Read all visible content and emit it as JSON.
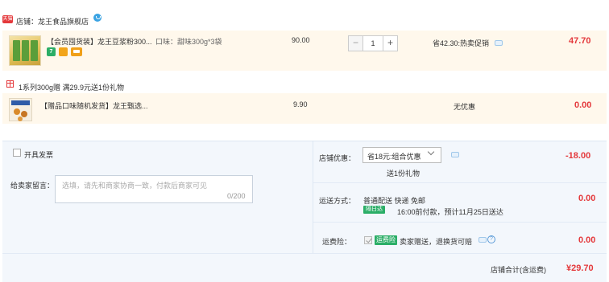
{
  "store": {
    "logo_text": "天猫",
    "label": "店铺：龙王食品旗舰店"
  },
  "products": [
    {
      "title": "【会员囤货装】龙王豆浆粉300...",
      "flavor": "口味：甜味300g*3袋",
      "badges": [
        "7",
        "",
        ""
      ],
      "price": "90.00",
      "quantity": "1",
      "promo": "省42.30:热卖促销",
      "total": "47.70"
    },
    {
      "title": "【赠品口味随机发货】龙王甄选...",
      "price": "9.90",
      "promo": "无优惠",
      "total": "0.00"
    }
  ],
  "gift": {
    "label": "1系列300g赠    满29.9元送1份礼物"
  },
  "quantity_controls": {
    "minus": "−",
    "plus": "+"
  },
  "order_options": {
    "invoice_label": "开具发票",
    "message_label": "给卖家留言：",
    "message_placeholder": "选填，请先和商家协商一致，付款后商家可见",
    "message_count": "0/200"
  },
  "coupon": {
    "label": "店铺优惠：",
    "selected": "省18元:组合优惠",
    "gift_note": "送1份礼物",
    "amount": "-18.00"
  },
  "shipping": {
    "label": "运送方式：",
    "method": "普通配送 快递 免邮",
    "tag": "隔日达",
    "detail": "16:00前付款，预计11月25日送达",
    "amount": "0.00"
  },
  "insurance": {
    "label": "运费险：",
    "tag": "运费险",
    "text": "卖家赠送，退换货可赔",
    "help": "?",
    "amount": "0.00"
  },
  "summary": {
    "label": "店铺合计(含运费)",
    "amount": "¥29.70"
  },
  "colors": {
    "price_red": "#e4393c",
    "row_highlight": "#fff8ec",
    "panel_bg": "#f3f7fc",
    "tag_green": "#2bae67"
  },
  "icons": [
    "store-logo-icon",
    "chat-icon",
    "gift-icon",
    "help-icon",
    "chevron-down-icon"
  ]
}
